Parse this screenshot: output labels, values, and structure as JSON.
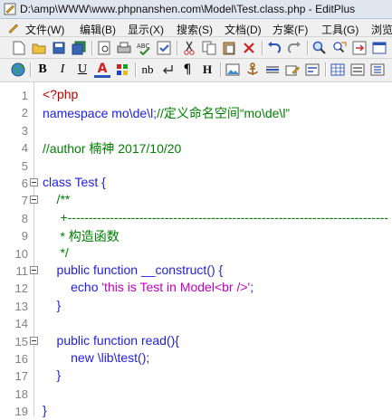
{
  "window": {
    "title": "D:\\amp\\WWW\\www.phpnanshen.com\\Model\\Test.class.php - EditPlus"
  },
  "menu": [
    {
      "label": "文件(W)",
      "icon": "file-menu-icon"
    },
    {
      "label": "编辑(B)"
    },
    {
      "label": "显示(X)"
    },
    {
      "label": "搜索(S)"
    },
    {
      "label": "文档(D)"
    },
    {
      "label": "方案(F)"
    },
    {
      "label": "工具(G)"
    },
    {
      "label": "浏览"
    }
  ],
  "toolbar1_icons": [
    "new-file-icon",
    "open-folder-icon",
    "save-icon",
    "save-all-icon",
    "print-preview-icon",
    "print-icon",
    "spellcheck-icon",
    "check-icon",
    "cut-icon",
    "copy-icon",
    "paste-icon",
    "delete-icon",
    "undo-icon",
    "redo-icon",
    "search-icon",
    "replace-icon",
    "goto-icon",
    "settings-icon"
  ],
  "toolbar2": {
    "bold": "B",
    "italic": "I",
    "underline": "U",
    "font_color": "A",
    "nbsp": "nb",
    "pilcrow": "¶",
    "heading": "H"
  },
  "code": {
    "lines": [
      {
        "n": "1",
        "parts": [
          {
            "c": "red",
            "t": "<?php"
          }
        ]
      },
      {
        "n": "2",
        "parts": [
          {
            "c": "kw",
            "t": "namespace mo\\de\\l;"
          },
          {
            "c": "cm",
            "t": "//定义命名空间“mo\\de\\l”"
          }
        ]
      },
      {
        "n": "3",
        "parts": []
      },
      {
        "n": "4",
        "parts": [
          {
            "c": "cm",
            "t": "//author 楠神 2017/10/20"
          }
        ]
      },
      {
        "n": "5",
        "parts": []
      },
      {
        "n": "6",
        "fold": true,
        "parts": [
          {
            "c": "kw",
            "t": "class Test {"
          }
        ]
      },
      {
        "n": "7",
        "fold": true,
        "parts": [
          {
            "c": "cm",
            "t": "    /**"
          }
        ]
      },
      {
        "n": "8",
        "parts": [
          {
            "c": "cm",
            "t": "     +----------------------------------------------------------------------------"
          }
        ]
      },
      {
        "n": "9",
        "parts": [
          {
            "c": "cm",
            "t": "     * 构造函数"
          }
        ]
      },
      {
        "n": "10",
        "parts": [
          {
            "c": "cm",
            "t": "     */"
          }
        ]
      },
      {
        "n": "11",
        "fold": true,
        "parts": [
          {
            "c": "kw",
            "t": "    public function __construct() {"
          }
        ]
      },
      {
        "n": "12",
        "parts": [
          {
            "c": "kw",
            "t": "        echo "
          },
          {
            "c": "st",
            "t": "'this is Test in Model<br />'"
          },
          {
            "c": "kw",
            "t": ";"
          }
        ]
      },
      {
        "n": "13",
        "parts": [
          {
            "c": "kw",
            "t": "    }"
          }
        ]
      },
      {
        "n": "14",
        "parts": []
      },
      {
        "n": "15",
        "fold": true,
        "parts": [
          {
            "c": "kw",
            "t": "    public function read(){"
          }
        ]
      },
      {
        "n": "16",
        "parts": [
          {
            "c": "kw",
            "t": "        new \\lib\\test();"
          }
        ]
      },
      {
        "n": "17",
        "parts": [
          {
            "c": "kw",
            "t": "    }"
          }
        ]
      },
      {
        "n": "18",
        "parts": []
      },
      {
        "n": "19",
        "parts": [
          {
            "c": "kw",
            "t": "}"
          }
        ]
      }
    ]
  }
}
